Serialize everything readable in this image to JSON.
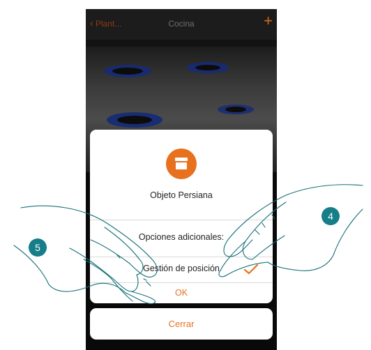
{
  "nav": {
    "back_label": "Plant...",
    "title": "Cocina",
    "add_label": "+"
  },
  "dialog": {
    "object_label": "Objeto Persiana",
    "options_title": "Opciones adicionales:",
    "option": {
      "label": "Gestión de posición",
      "checked": true
    },
    "ok_label": "OK"
  },
  "close_label": "Cerrar",
  "steps": [
    "5",
    "4"
  ],
  "colors": {
    "accent": "#e8711e",
    "step_badge": "#157e88"
  }
}
